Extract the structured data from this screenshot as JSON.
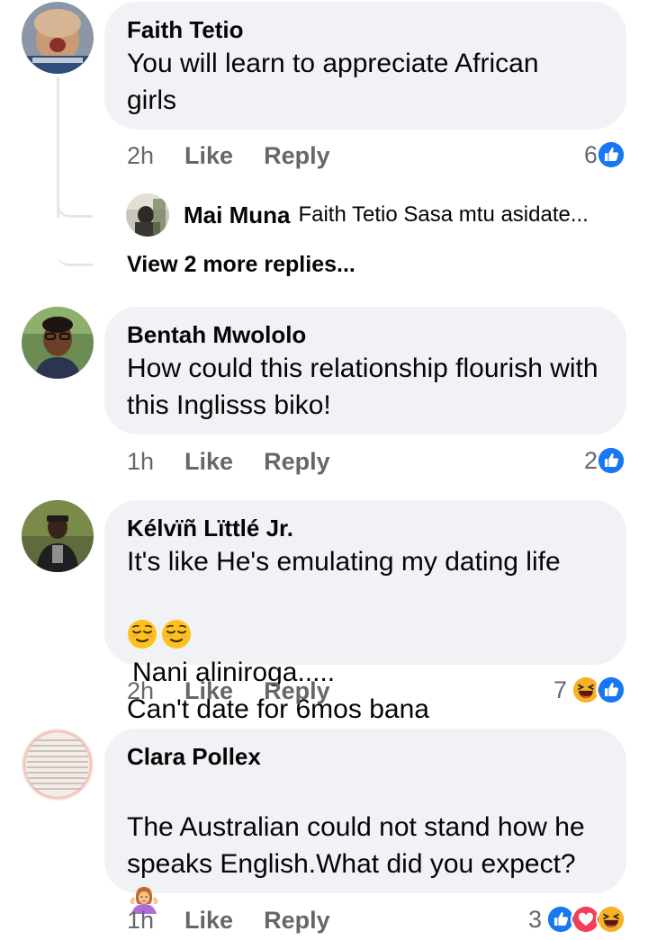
{
  "comments": [
    {
      "author": "Faith Tetio",
      "text": "You will learn to appreciate African girls",
      "time": "2h",
      "like": "Like",
      "reply": "Reply",
      "reaction_count": "6",
      "reactions": [
        "like"
      ],
      "replies": {
        "author": "Mai Muna",
        "snippet": "Faith Tetio Sasa mtu asidate...",
        "view_more": "View 2 more replies..."
      }
    },
    {
      "author": "Bentah Mwololo",
      "text": "How could this relationship flourish with this Inglisss biko!",
      "time": "1h",
      "like": "Like",
      "reply": "Reply",
      "reaction_count": "2",
      "reactions": [
        "like"
      ]
    },
    {
      "author": "Kélvïñ Lïttlé Jr.",
      "text_line1": "It's like He's emulating my dating life",
      "text_line2_emoji": [
        "relieved-face-emoji",
        "relieved-face-emoji"
      ],
      "text_line2": "Nani aliniroga.....",
      "text_line3": "Can't date for 6mos bana",
      "time": "2h",
      "like": "Like",
      "reply": "Reply",
      "reaction_count": "7",
      "reactions": [
        "haha",
        "like"
      ]
    },
    {
      "author": "Clara Pollex",
      "text": "The Australian could not stand how he speaks English.What did you expect?",
      "text_emoji": "shrugging-woman-emoji",
      "time": "1h",
      "like": "Like",
      "reply": "Reply",
      "reaction_count": "3",
      "reactions": [
        "like",
        "love",
        "haha"
      ]
    }
  ],
  "colors": {
    "bubble": "#f0f2f5",
    "meta_text": "#65676b",
    "like_blue": "#1877f2",
    "love_red": "#f33e58",
    "haha_yellow": "#f7b125"
  }
}
